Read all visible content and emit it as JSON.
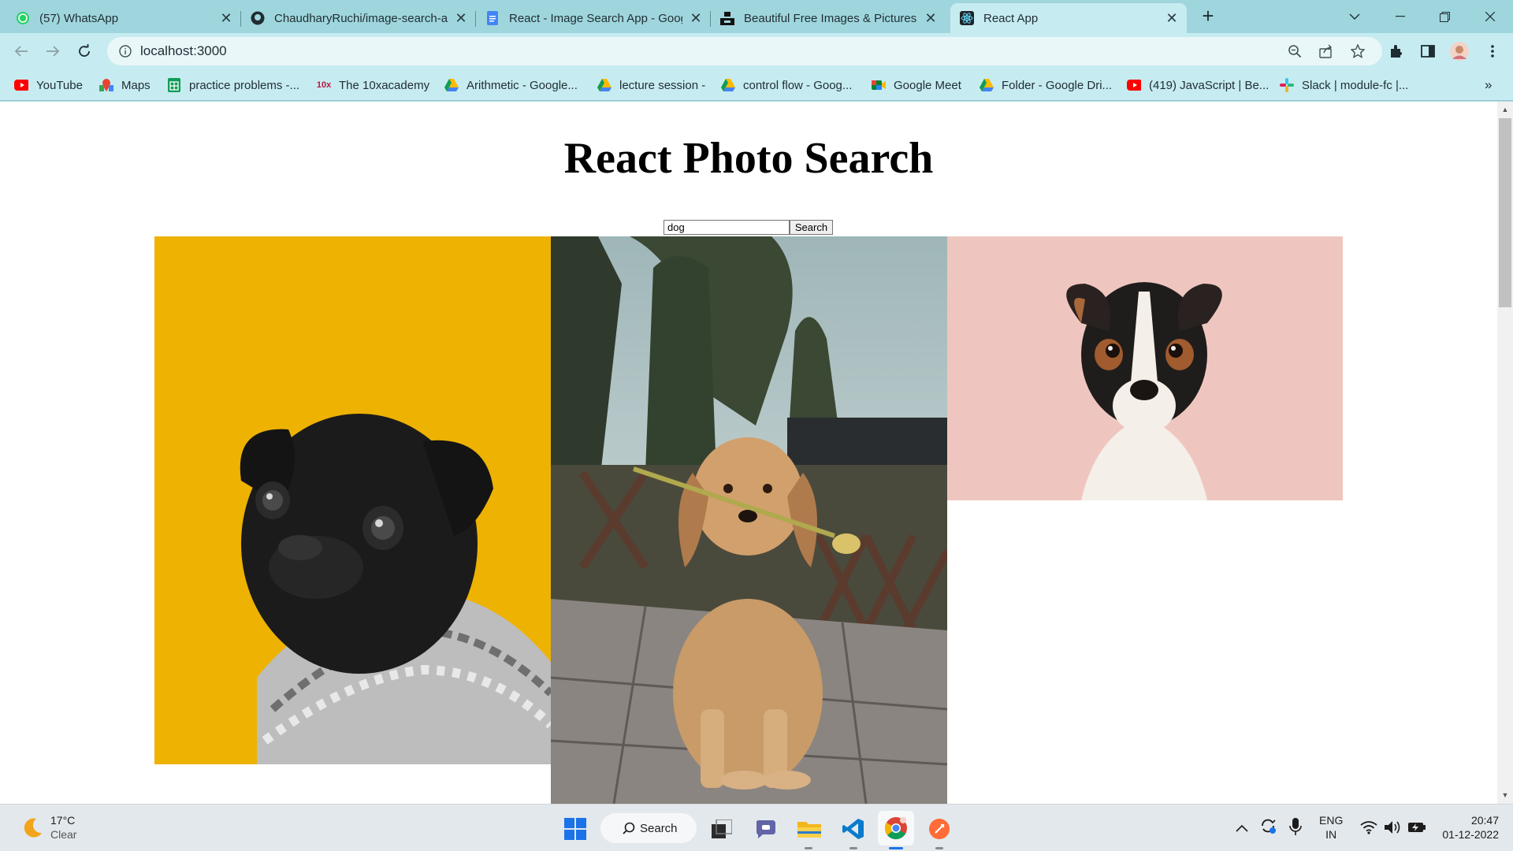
{
  "browser": {
    "tabs": [
      {
        "title": "(57) WhatsApp",
        "icon": "whatsapp-icon"
      },
      {
        "title": "ChaudharyRuchi/image-search-a",
        "icon": "github-icon"
      },
      {
        "title": "React - Image Search App - Goog",
        "icon": "google-docs-icon"
      },
      {
        "title": "Beautiful Free Images & Pictures",
        "icon": "unsplash-icon"
      },
      {
        "title": "React App",
        "icon": "react-icon",
        "active": true
      }
    ],
    "url": "localhost:3000",
    "bookmarks": [
      {
        "label": "YouTube",
        "icon": "youtube-icon"
      },
      {
        "label": "Maps",
        "icon": "maps-icon"
      },
      {
        "label": "practice problems -...",
        "icon": "sheets-icon"
      },
      {
        "label": "The 10xacademy",
        "icon": "10x-icon"
      },
      {
        "label": "Arithmetic - Google...",
        "icon": "drive-icon"
      },
      {
        "label": "lecture session -",
        "icon": "drive-icon"
      },
      {
        "label": "control flow - Goog...",
        "icon": "drive-icon"
      },
      {
        "label": "Google Meet",
        "icon": "meet-icon"
      },
      {
        "label": "Folder - Google Dri...",
        "icon": "drive-icon"
      },
      {
        "label": "(419) JavaScript | Be...",
        "icon": "youtube-icon"
      },
      {
        "label": "Slack | module-fc |...",
        "icon": "slack-icon"
      }
    ],
    "bookmarks_overflow": "»"
  },
  "page": {
    "heading": "React Photo Search",
    "search_value": "dog",
    "search_button": "Search",
    "photos": [
      {
        "subject": "black pug in knitted sweater",
        "background": "#f0b400"
      },
      {
        "subject": "golden retriever holding a flower",
        "background": "#7a8a7e"
      },
      {
        "subject": "jack russell terrier",
        "background": "#efc3bd"
      }
    ]
  },
  "taskbar": {
    "weather_temp": "17°C",
    "weather_desc": "Clear",
    "search_label": "Search",
    "lang_top": "ENG",
    "lang_bottom": "IN",
    "time": "20:47",
    "date": "01-12-2022"
  }
}
